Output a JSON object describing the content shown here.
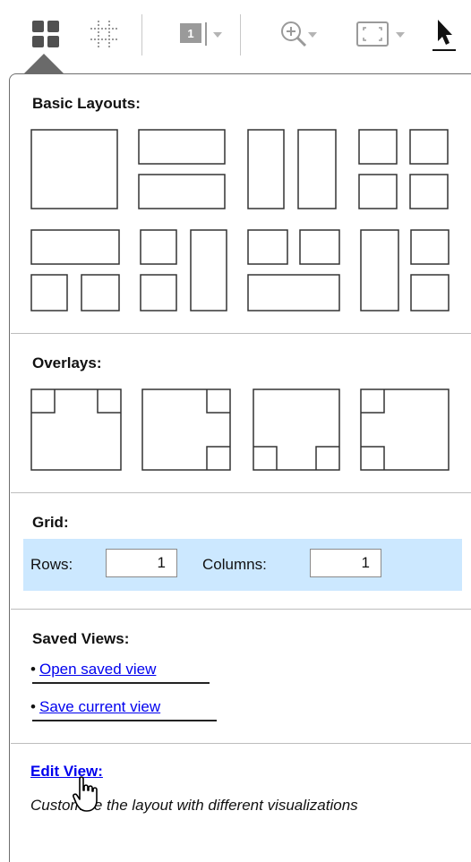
{
  "toolbar": {
    "buttons": [
      {
        "name": "layout-tiles-icon",
        "selected": true
      },
      {
        "name": "grid-tiles-icon",
        "selected": false
      },
      {
        "name": "view-numbering-icon",
        "badge": "1",
        "dropdown": true
      },
      {
        "name": "zoom-in-icon",
        "dropdown": true
      },
      {
        "name": "fit-to-frame-icon",
        "dropdown": true
      },
      {
        "name": "select-pointer-icon"
      }
    ]
  },
  "basic_layouts": {
    "title": "Basic Layouts:",
    "items": [
      "single-full",
      "two-rows",
      "two-columns",
      "two-by-two",
      "top-wide-two-bottom",
      "left-two-right-tall",
      "top-two-bottom-wide",
      "left-tall-right-two"
    ]
  },
  "overlays": {
    "title": "Overlays:",
    "items": [
      "overlay-top-corners",
      "overlay-right-corners",
      "overlay-bottom-corners",
      "overlay-left-corners"
    ]
  },
  "grid": {
    "title": "Grid:",
    "rows_label": "Rows:",
    "rows_value": "1",
    "columns_label": "Columns:",
    "columns_value": "1"
  },
  "saved_views": {
    "title": "Saved Views:",
    "bullet": "•",
    "open_label": "Open saved view",
    "save_label": "Save current view"
  },
  "edit_view": {
    "link_label": "Edit View:",
    "description": "Customize the layout with different visualizations"
  },
  "colors": {
    "accent_highlight": "#cce8ff",
    "link": "#0000ee",
    "separator": "#bdbdbd"
  }
}
